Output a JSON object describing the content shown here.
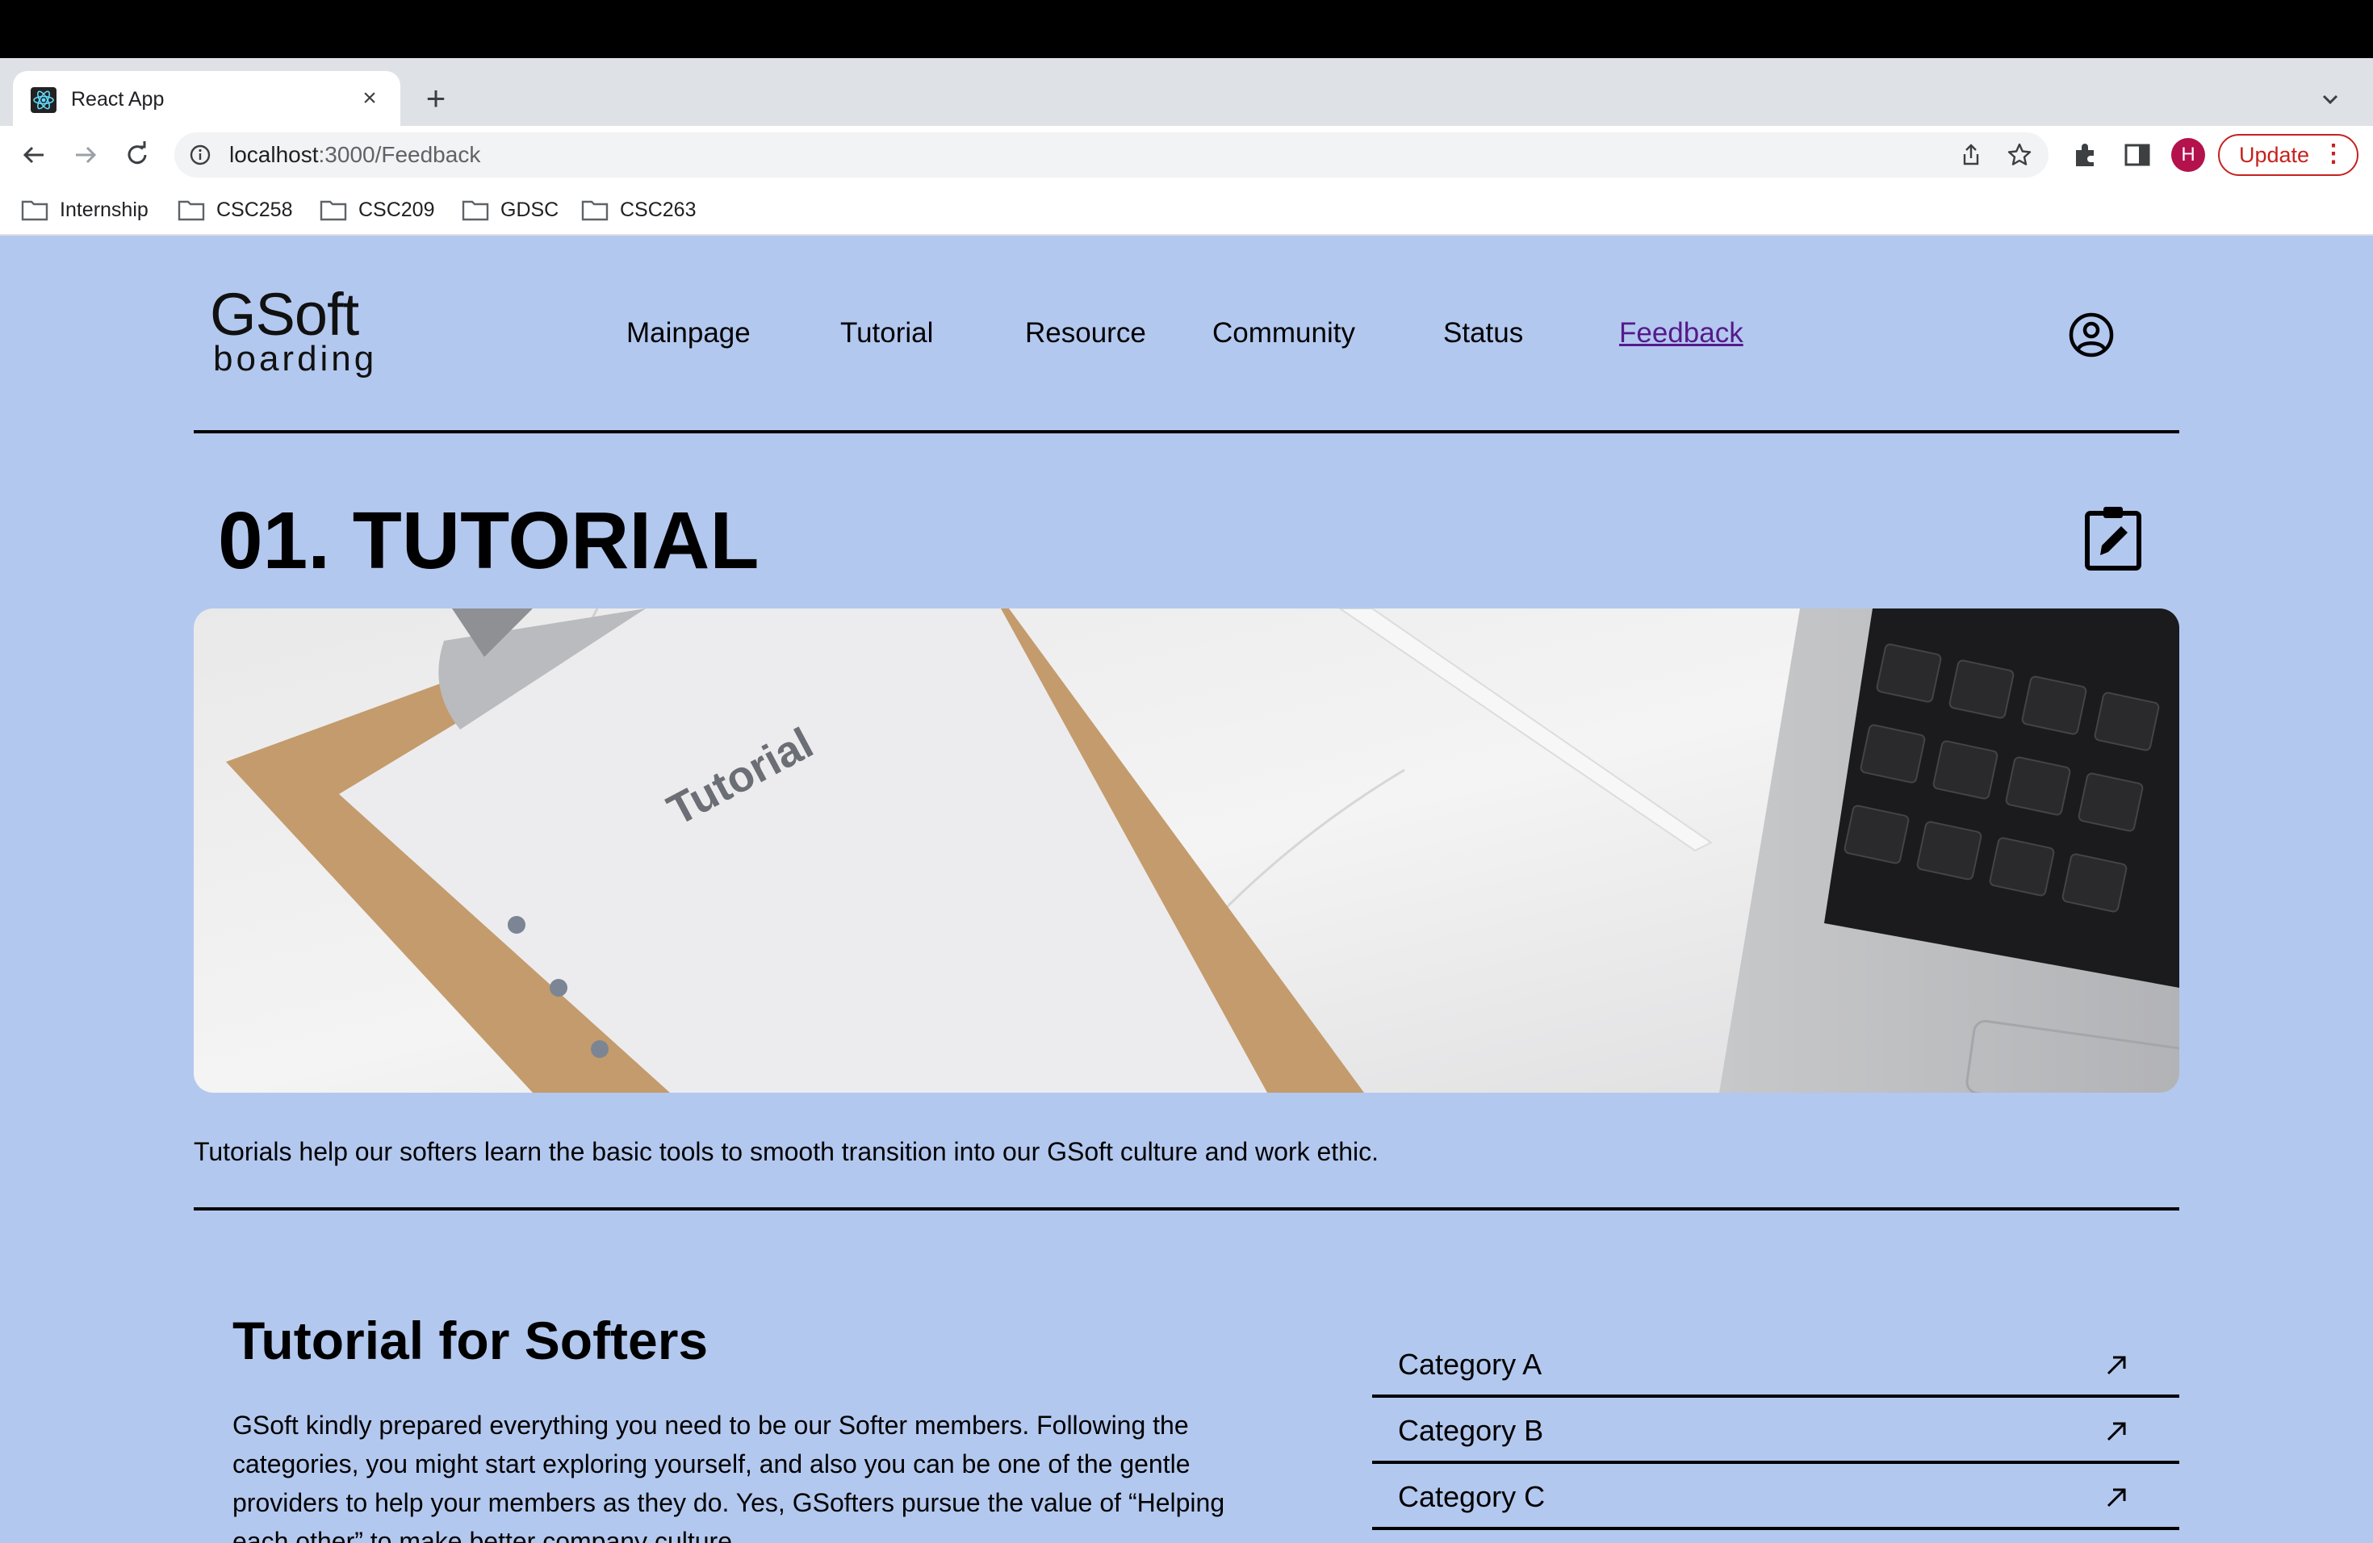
{
  "browser": {
    "tab_title": "React App",
    "url_host": "localhost",
    "url_rest": ":3000/Feedback",
    "update_label": "Update",
    "profile_initial": "H",
    "bookmarks": [
      "Internship",
      "CSC258",
      "CSC209",
      "GDSC",
      "CSC263"
    ]
  },
  "site": {
    "logo_main": "GSoft",
    "logo_sub": "boarding",
    "nav": {
      "mainpage": "Mainpage",
      "tutorial": "Tutorial",
      "resource": "Resource",
      "community": "Community",
      "status": "Status",
      "feedback": "Feedback"
    }
  },
  "main": {
    "section_title": "01. TUTORIAL",
    "hero_text": "Tutorial",
    "intro": "Tutorials help our softers learn the basic tools to smooth transition into our GSoft culture and work ethic.",
    "sub_title": "Tutorial for Softers",
    "sub_body": "GSoft kindly prepared everything you need to be our Softer members. Following the categories, you might start exploring yourself, and also you can be one of the gentle providers to help your members as they do. Yes, GSofters pursue the value of “Helping each other” to make better company culture.",
    "categories": [
      "Category A",
      "Category B",
      "Category C"
    ]
  },
  "colors": {
    "page_bg": "#b3c8ef",
    "active_link": "#551a8b",
    "update_red": "#c5221f"
  }
}
